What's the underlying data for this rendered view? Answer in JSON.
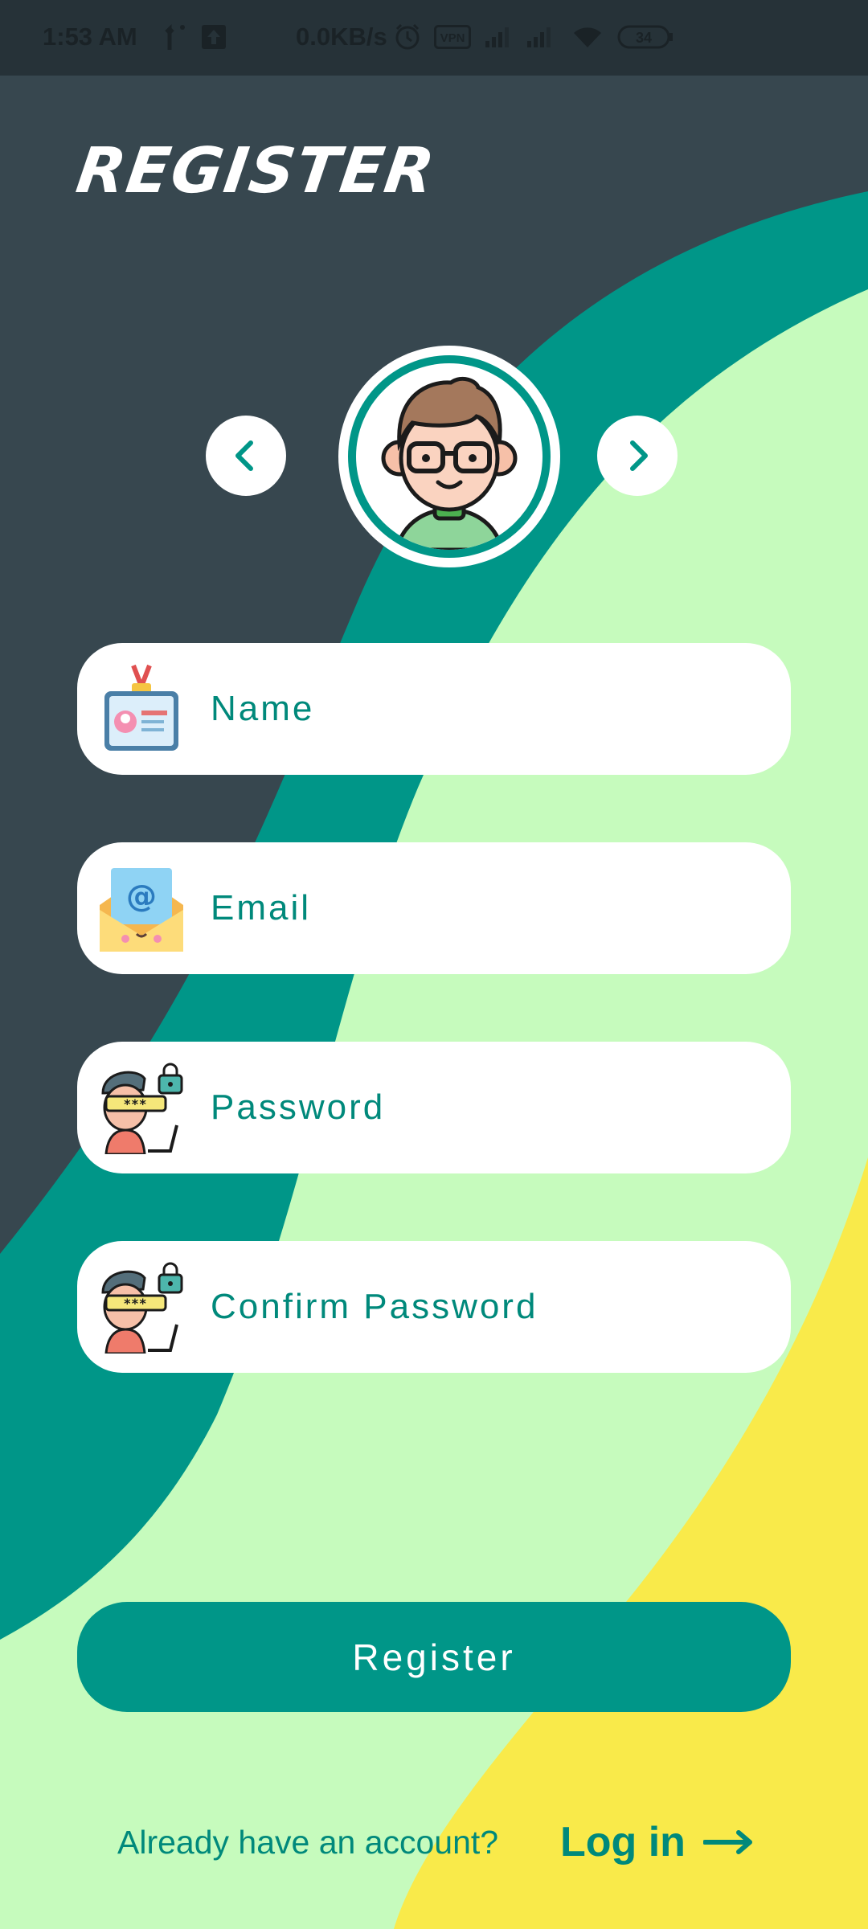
{
  "status_bar": {
    "time": "1:53 AM",
    "network_speed": "0.0KB/s",
    "vpn_label": "VPN",
    "battery": "34",
    "icons": [
      "upload-arrow-icon",
      "data-activity-icon",
      "alarm-icon",
      "vpn-icon",
      "cell-signal-icon",
      "cell-signal-icon",
      "wifi-icon",
      "battery-icon"
    ]
  },
  "page": {
    "title": "REGISTER"
  },
  "avatar_picker": {
    "prev_icon": "chevron-left-icon",
    "next_icon": "chevron-right-icon",
    "avatar_icon": "boy-with-glasses-avatar"
  },
  "form": {
    "fields": [
      {
        "id": "name",
        "placeholder": "Name",
        "value": "",
        "icon": "id-badge-icon"
      },
      {
        "id": "email",
        "placeholder": "Email",
        "value": "",
        "icon": "envelope-at-icon"
      },
      {
        "id": "password",
        "placeholder": "Password",
        "value": "",
        "icon": "password-user-icon"
      },
      {
        "id": "confirm_password",
        "placeholder": "Confirm Password",
        "value": "",
        "icon": "password-user-icon"
      }
    ],
    "submit_label": "Register"
  },
  "footer": {
    "prompt": "Already have an account?",
    "login_label": "Log in",
    "login_icon": "arrow-right-icon"
  },
  "colors": {
    "background_dark": "#37474f",
    "status_bar": "#263238",
    "teal": "#009688",
    "teal_text": "#00897b",
    "mint": "#c6fbbd",
    "yellow": "#f9ea4a",
    "white": "#ffffff"
  }
}
